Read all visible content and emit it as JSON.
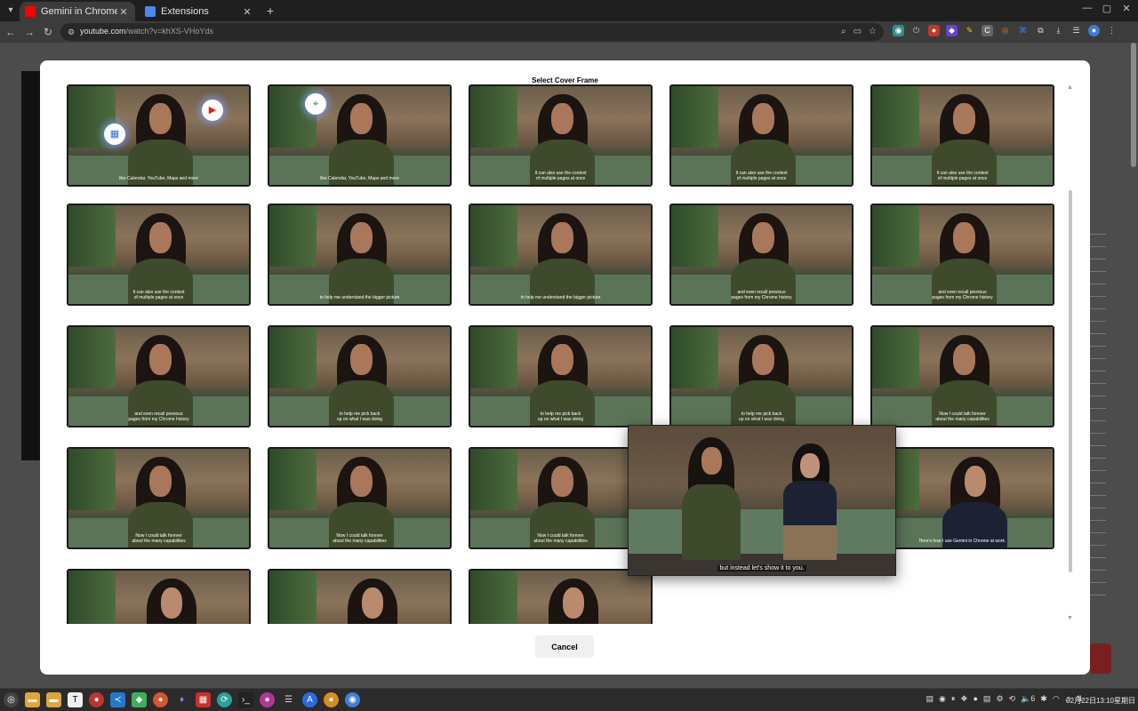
{
  "browser": {
    "tabs": [
      {
        "title": "Gemini in Chrome, your A",
        "icon": "youtube-icon",
        "active": true
      },
      {
        "title": "Extensions",
        "icon": "puzzle-icon",
        "active": false
      }
    ],
    "url_host": "youtube.com",
    "url_path": "/watch?v=khXS-VHoYds"
  },
  "modal": {
    "title": "Select Cover Frame",
    "cancel_label": "Cancel"
  },
  "frames": [
    {
      "caption": "like Calendar, YouTube, Maps and more",
      "badges": [
        "calendar-icon",
        "youtube-icon"
      ]
    },
    {
      "caption": "like Calendar, YouTube, Maps and more",
      "badges": [
        "maps-icon"
      ]
    },
    {
      "caption": "It can also use the context\nof multiple pages at once"
    },
    {
      "caption": "It can also use the context\nof multiple pages at once"
    },
    {
      "caption": "It can also use the context\nof multiple pages at once"
    },
    {
      "caption": "It can also use the context\nof multiple pages at once"
    },
    {
      "caption": "to help me understand the bigger picture"
    },
    {
      "caption": "to help me understand the bigger picture"
    },
    {
      "caption": "and even recall previous\npages from my Chrome history"
    },
    {
      "caption": "and even recall previous\npages from my Chrome history"
    },
    {
      "caption": "and even recall previous\npages from my Chrome history"
    },
    {
      "caption": "to help me pick back\nup on what I was doing"
    },
    {
      "caption": "to help me pick back\nup on what I was doing"
    },
    {
      "caption": "to help me pick back\nup on what I was doing"
    },
    {
      "caption": "Now I could talk forever\nabout the many capabilities"
    },
    {
      "caption": "Now I could talk forever\nabout the many capabilities"
    },
    {
      "caption": "Now I could talk forever\nabout the many capabilities"
    },
    {
      "caption": "Now I could talk forever\nabout the many capabilities"
    },
    {
      "caption": ""
    },
    {
      "caption": "Here's how I use Gemini in Chrome at work.",
      "dark_shirt": true
    },
    {
      "caption": "",
      "dark_shirt": true
    },
    {
      "caption": "",
      "dark_shirt": true
    },
    {
      "caption": "",
      "dark_shirt": true
    }
  ],
  "preview": {
    "caption": "but instead let's show it to you."
  },
  "taskbar": {
    "clock": "02月22日13:10星期日",
    "volume": "6"
  }
}
